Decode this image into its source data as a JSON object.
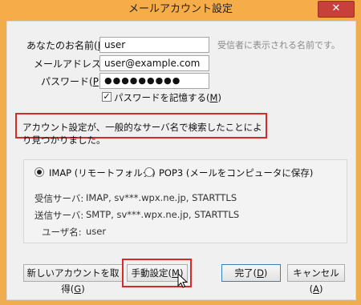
{
  "window": {
    "title": "メールアカウント設定",
    "close_icon": "close-icon"
  },
  "form": {
    "name": {
      "label_pre": "あなたのお名前(",
      "accel": "N",
      "label_post": "):",
      "value": "user",
      "hint": "受信者に表示される名前です。"
    },
    "email": {
      "label_pre": "メールアドレス(",
      "accel": "L",
      "label_post": "):",
      "value": "user@example.com"
    },
    "password": {
      "label_pre": "パスワード(",
      "accel": "P",
      "label_post": "):",
      "value": "●●●●●●●●●"
    },
    "remember": {
      "checked": true,
      "label_pre": "パスワードを記憶する(",
      "accel": "M",
      "label_post": ")"
    }
  },
  "status_message": "アカウント設定が、一般的なサーバ名で検索したことにより見つかりました。",
  "protocol": {
    "imap": {
      "label": "IMAP (リモートフォルダ)",
      "selected": true
    },
    "pop3": {
      "label": "POP3 (メールをコンピュータに保存)",
      "selected": false
    }
  },
  "server_info": {
    "incoming": {
      "label": "受信サーバ:",
      "value": "IMAP, sv***.wpx.ne.jp, STARTTLS"
    },
    "outgoing": {
      "label": "送信サーバ:",
      "value": "SMTP, sv***.wpx.ne.jp, STARTTLS"
    },
    "username": {
      "label": "ユーザ名:",
      "value": "user"
    }
  },
  "buttons": {
    "new_account": {
      "pre": "新しいアカウントを取得(",
      "accel": "G",
      "post": ")"
    },
    "manual": {
      "pre": "手動設定(",
      "accel": "M",
      "post": ")"
    },
    "done": {
      "pre": "完了(",
      "accel": "D",
      "post": ")"
    },
    "cancel": {
      "pre": "キャンセル(",
      "accel": "A",
      "post": ")"
    }
  },
  "colors": {
    "title_bar": "#f6ac48",
    "close_button": "#c7413a",
    "highlight": "#d92a2a"
  }
}
